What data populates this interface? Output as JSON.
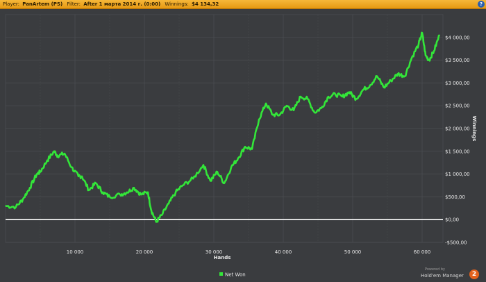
{
  "header": {
    "player_label": "Player:",
    "player_value": "PanArtem (PS)",
    "filter_label": "Filter:",
    "filter_value": "After 1 марта 2014 г. (0:00)",
    "winnings_label": "Winnings:",
    "winnings_value": "$4 134,32",
    "help_icon": "question-icon",
    "help_glyph": "?"
  },
  "branding": {
    "powered_by": "Powered by",
    "product": "Hold'em Manager",
    "badge": "2"
  },
  "colors": {
    "background": "#3a3c3f",
    "grid": "#4c4f53",
    "series": "#33e639",
    "zero_line": "#ffffff",
    "tick_text": "#e8e8e8"
  },
  "chart_data": {
    "type": "line",
    "xlabel": "Hands",
    "ylabel": "Winnings",
    "xlim": [
      0,
      63000
    ],
    "ylim": [
      -500,
      4500
    ],
    "x_ticks": [
      10000,
      20000,
      30000,
      40000,
      50000,
      60000
    ],
    "x_tick_labels": [
      "10 000",
      "20 000",
      "30 000",
      "40 000",
      "50 000",
      "60 000"
    ],
    "y_ticks": [
      -500,
      0,
      500,
      1000,
      1500,
      2000,
      2500,
      3000,
      3500,
      4000
    ],
    "y_tick_labels": [
      "-$500,00",
      "$0,00",
      "$500,00",
      "$1 000,00",
      "$1 500,00",
      "$2 000,00",
      "$2 500,00",
      "$3 000,00",
      "$3 500,00",
      "$4 000,00"
    ],
    "legend": "bottom-center",
    "grid": true,
    "series": [
      {
        "name": "Net Won",
        "x": [
          0,
          1500,
          2500,
          3500,
          4500,
          5000,
          6000,
          7000,
          7500,
          8500,
          9500,
          10500,
          11000,
          12000,
          13000,
          14000,
          15000,
          16500,
          17500,
          18500,
          19500,
          20500,
          21000,
          21700,
          22500,
          23500,
          24500,
          25500,
          27000,
          28500,
          29500,
          30500,
          31500,
          32500,
          33500,
          34500,
          35500,
          36500,
          37500,
          38500,
          39500,
          40500,
          41500,
          42500,
          43500,
          44500,
          45500,
          46500,
          47500,
          48500,
          49500,
          50500,
          51500,
          52500,
          53500,
          54500,
          55500,
          56500,
          57500,
          58500,
          59500,
          60000,
          60500,
          61000,
          61700,
          62500
        ],
        "y": [
          300,
          280,
          450,
          700,
          1000,
          1050,
          1300,
          1500,
          1400,
          1450,
          1150,
          950,
          950,
          650,
          800,
          600,
          500,
          550,
          600,
          700,
          550,
          600,
          200,
          -50,
          100,
          350,
          600,
          750,
          900,
          1200,
          850,
          1050,
          800,
          1150,
          1350,
          1600,
          1550,
          2200,
          2550,
          2300,
          2300,
          2500,
          2400,
          2700,
          2650,
          2350,
          2450,
          2700,
          2750,
          2700,
          2800,
          2650,
          2850,
          2950,
          3150,
          2900,
          3050,
          3200,
          3150,
          3550,
          3850,
          4100,
          3600,
          3500,
          3700,
          4050
        ]
      }
    ]
  }
}
